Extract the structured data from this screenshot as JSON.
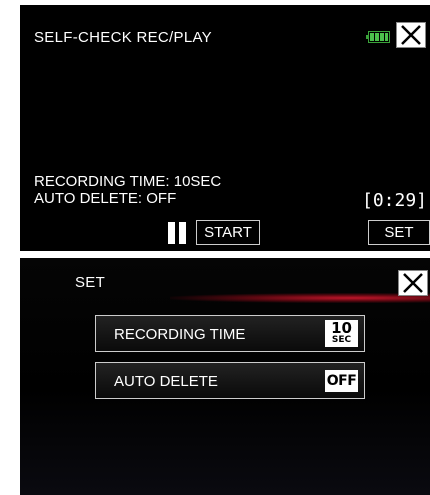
{
  "screen1": {
    "title": "SELF-CHECK REC/PLAY",
    "battery_icon": "battery-icon",
    "close_icon": "close-icon",
    "recording_time_line": "RECORDING TIME: 10SEC",
    "auto_delete_line": "AUTO DELETE: OFF",
    "time_display": "[0:29]",
    "pause_icon": "pause-icon",
    "start_label": "START",
    "set_label": "SET"
  },
  "screen2": {
    "title": "SET",
    "close_icon": "close-icon",
    "menu": [
      {
        "label": "RECORDING TIME",
        "badge_value": "10",
        "badge_unit": "SEC"
      },
      {
        "label": "AUTO DELETE",
        "badge_value": "OFF"
      }
    ]
  },
  "colors": {
    "background": "#000000",
    "battery": "#4cc24c",
    "accent_glow": "#c0162a"
  }
}
